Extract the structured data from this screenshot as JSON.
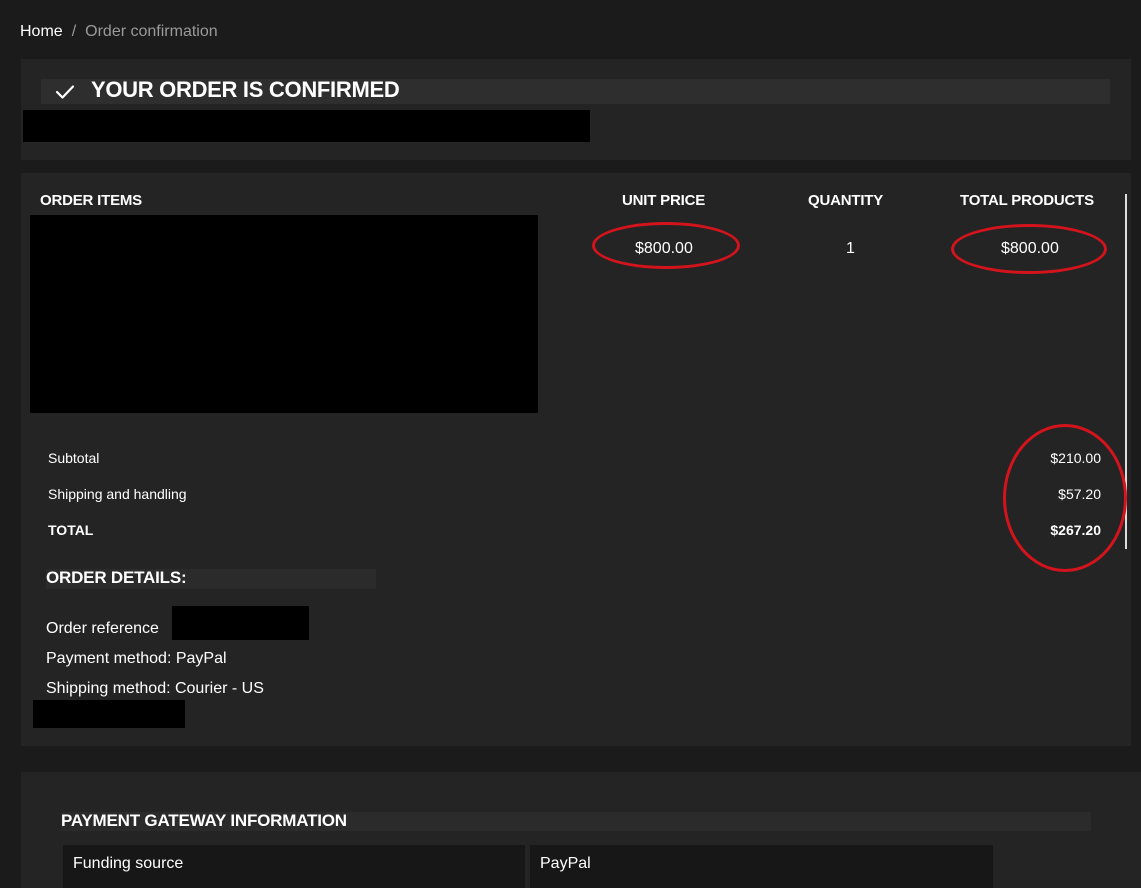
{
  "breadcrumb": {
    "home": "Home",
    "separator": "/",
    "current": "Order confirmation"
  },
  "confirmation": {
    "title": "YOUR ORDER IS CONFIRMED",
    "icon": "check-icon"
  },
  "order_items": {
    "headers": {
      "items": "ORDER ITEMS",
      "unit_price": "UNIT PRICE",
      "quantity": "QUANTITY",
      "total_products": "TOTAL PRODUCTS"
    },
    "rows": [
      {
        "unit_price": "$800.00",
        "quantity": "1",
        "total": "$800.00"
      }
    ]
  },
  "summary": {
    "subtotal_label": "Subtotal",
    "subtotal_value": "$210.00",
    "shipping_label": "Shipping and handling",
    "shipping_value": "$57.20",
    "total_label": "TOTAL",
    "total_value": "$267.20"
  },
  "order_details": {
    "title": "ORDER DETAILS:",
    "reference_label": "Order reference",
    "payment_method": "Payment method: PayPal",
    "shipping_method": "Shipping method: Courier - US"
  },
  "payment_gateway": {
    "title": "PAYMENT GATEWAY INFORMATION",
    "rows": [
      {
        "label": "Funding source",
        "value": "PayPal"
      }
    ]
  },
  "colors": {
    "background": "#1b1b1b",
    "card": "#242424",
    "annotation": "#d4141c",
    "redaction": "#000000"
  }
}
